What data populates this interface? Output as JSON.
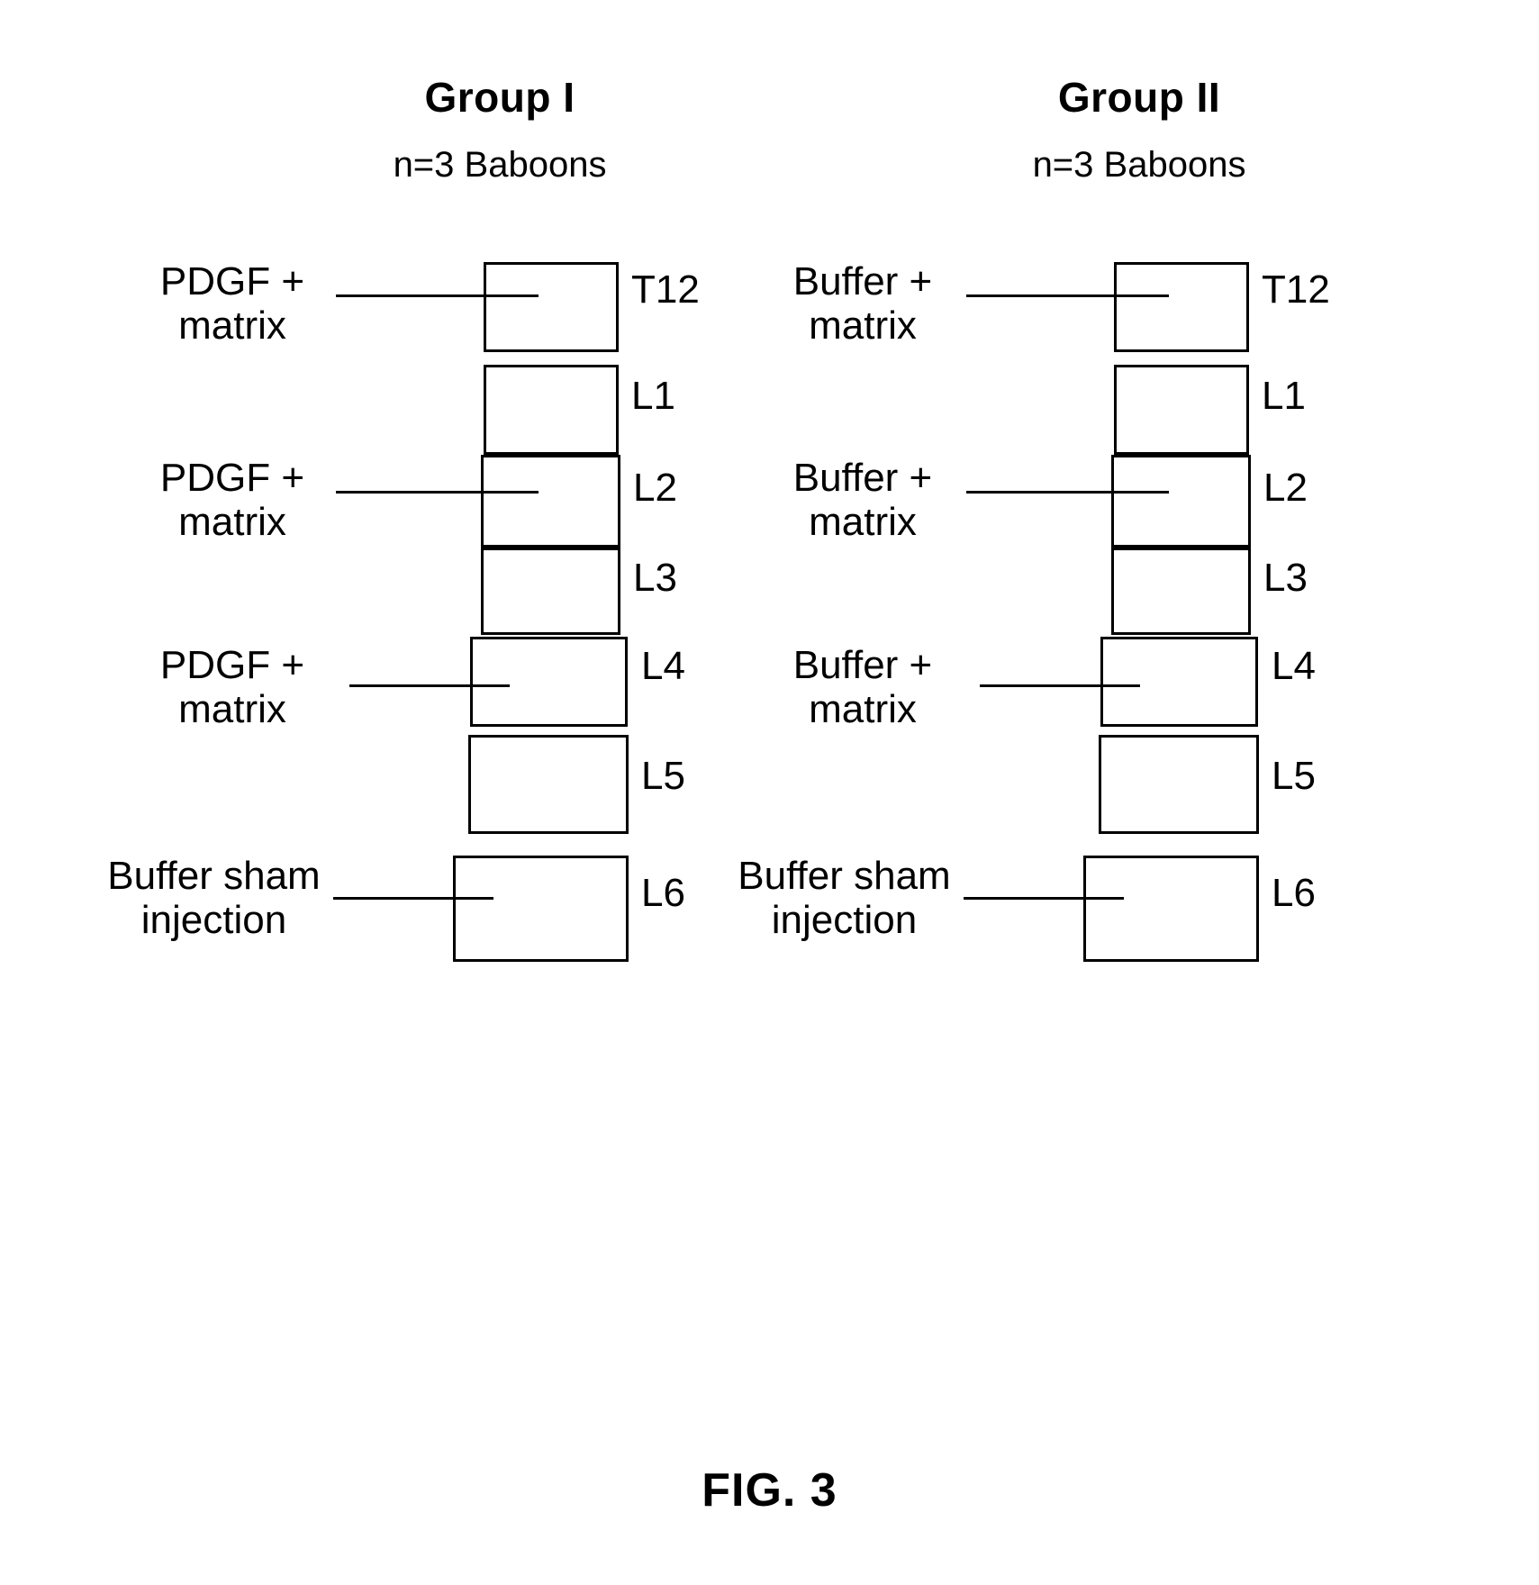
{
  "figure": {
    "caption": "FIG. 3"
  },
  "groups": [
    {
      "title": "Group I",
      "subtitle": "n=3 Baboons",
      "levels": [
        {
          "label": "T12"
        },
        {
          "label": "L1"
        },
        {
          "label": "L2"
        },
        {
          "label": "L3"
        },
        {
          "label": "L4"
        },
        {
          "label": "L5"
        },
        {
          "label": "L6"
        }
      ],
      "treatments": [
        {
          "target": "T12",
          "line1": "PDGF +",
          "line2": "matrix"
        },
        {
          "target": "L2",
          "line1": "PDGF +",
          "line2": "matrix"
        },
        {
          "target": "L4",
          "line1": "PDGF +",
          "line2": "matrix"
        },
        {
          "target": "L6",
          "line1": "Buffer sham",
          "line2": "injection"
        }
      ]
    },
    {
      "title": "Group II",
      "subtitle": "n=3 Baboons",
      "levels": [
        {
          "label": "T12"
        },
        {
          "label": "L1"
        },
        {
          "label": "L2"
        },
        {
          "label": "L3"
        },
        {
          "label": "L4"
        },
        {
          "label": "L5"
        },
        {
          "label": "L6"
        }
      ],
      "treatments": [
        {
          "target": "T12",
          "line1": "Buffer +",
          "line2": "matrix"
        },
        {
          "target": "L2",
          "line1": "Buffer +",
          "line2": "matrix"
        },
        {
          "target": "L4",
          "line1": "Buffer +",
          "line2": "matrix"
        },
        {
          "target": "L6",
          "line1": "Buffer sham",
          "line2": "injection"
        }
      ]
    }
  ],
  "style": {
    "stroke_color": "#000000",
    "background_color": "#ffffff"
  }
}
